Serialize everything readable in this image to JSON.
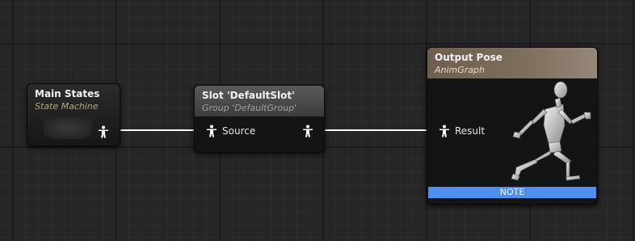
{
  "graph": {
    "nodes": {
      "main_states": {
        "title": "Main States",
        "subtitle": "State Machine"
      },
      "slot": {
        "title": "Slot 'DefaultSlot'",
        "subtitle": "Group 'DefaultGroup'",
        "input_pin": "Source"
      },
      "output_pose": {
        "title": "Output Pose",
        "subtitle": "AnimGraph",
        "input_pin": "Result",
        "note": "NOTE"
      }
    },
    "icons": {
      "pin": "pose-pin-icon",
      "preview": "mannequin-preview"
    }
  },
  "colors": {
    "wire": "#ffffff",
    "note_bar": "#4f8ff0",
    "output_header": "#7d6d5b"
  }
}
